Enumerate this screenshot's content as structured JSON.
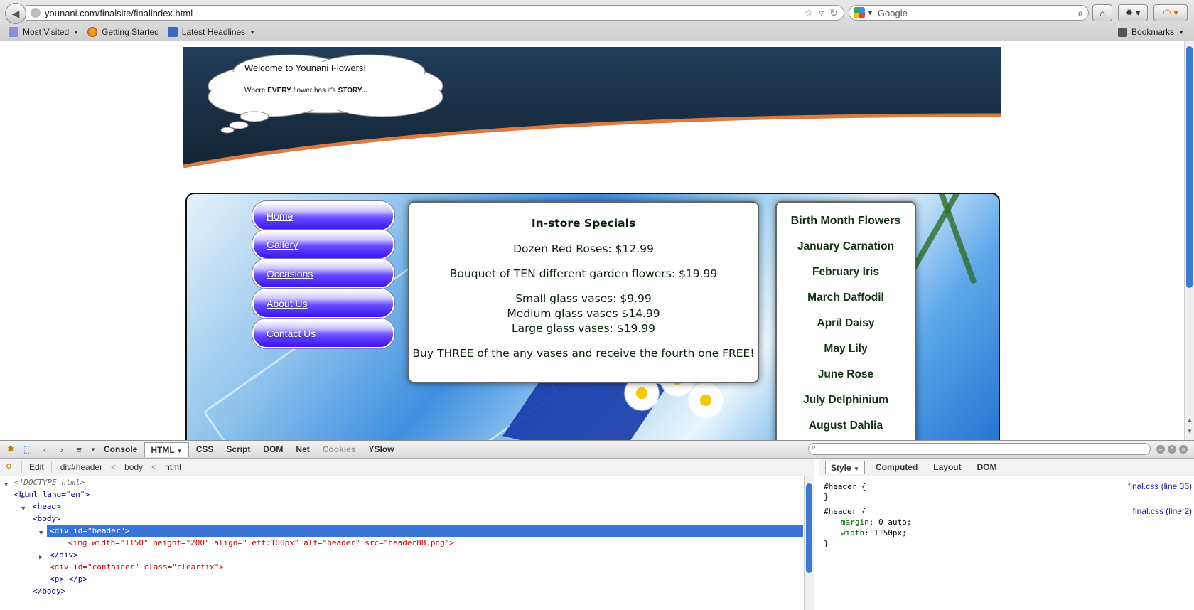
{
  "browser": {
    "url": "younani.com/finalsite/finalindex.html",
    "search_placeholder": "Google",
    "bookmarks": [
      "Most Visited",
      "Getting Started",
      "Latest Headlines"
    ],
    "bookmarks_menu": "Bookmarks"
  },
  "site": {
    "cloud_title": "Welcome to Younani Flowers!",
    "cloud_sub_prefix": "Where ",
    "cloud_sub_every": "EVERY",
    "cloud_sub_mid": " flower has it's ",
    "cloud_sub_story": "STORY...",
    "nav": [
      "Home",
      "Gallery",
      "Occasions",
      "About Us",
      "Contact Us"
    ],
    "specials": {
      "title": "In-store Specials",
      "lines": [
        "Dozen Red Roses: $12.99",
        "Bouquet of TEN different garden flowers: $19.99",
        "Small glass vases: $9.99",
        "Medium glass vases $14.99",
        "Large glass vases: $19.99",
        "Buy THREE of the any vases and receive the fourth one FREE!"
      ]
    },
    "birth": {
      "title": "Birth Month Flowers",
      "months": [
        "January Carnation",
        "February Iris",
        "March Daffodil",
        "April Daisy",
        "May Lily",
        "June Rose",
        "July Delphinium",
        "August Dahlia"
      ]
    }
  },
  "firebug": {
    "tabs": [
      "Console",
      "HTML",
      "CSS",
      "Script",
      "DOM",
      "Net",
      "Cookies",
      "YSlow"
    ],
    "crumbs": {
      "edit": "Edit",
      "items": [
        "div#header",
        "body",
        "html"
      ],
      "sep": "<"
    },
    "side_tabs": [
      "Style",
      "Computed",
      "Layout",
      "DOM"
    ],
    "html_lines": [
      "<!DOCTYPE html>",
      "<html lang=\"en\">",
      "<head>",
      "<body>",
      "<div id=\"header\">",
      "<img width=\"1150\" height=\"200\" align=\"left:100px\" alt=\"header\" src=\"header88.png\">",
      "</div>",
      "<div id=\"container\" class=\"clearfix\">",
      "<p> </p>",
      "</body>"
    ],
    "css": {
      "rule1_selector": "#header {",
      "rule1_close": "}",
      "rule1_link": "final.css (line 36)",
      "rule2_selector": "#header {",
      "rule2_prop1": "margin",
      "rule2_val1": "0 auto",
      "rule2_prop2": "width",
      "rule2_val2": "1150px",
      "rule2_close": "}",
      "rule2_link": "final.css (line 2)"
    }
  },
  "colors": {
    "header_navy": "#1a3047",
    "header_stripe": "#e0793f",
    "nav_button": "#3a12f2",
    "selection": "#3875d7",
    "scroll_thumb": "#3b7cd2"
  }
}
